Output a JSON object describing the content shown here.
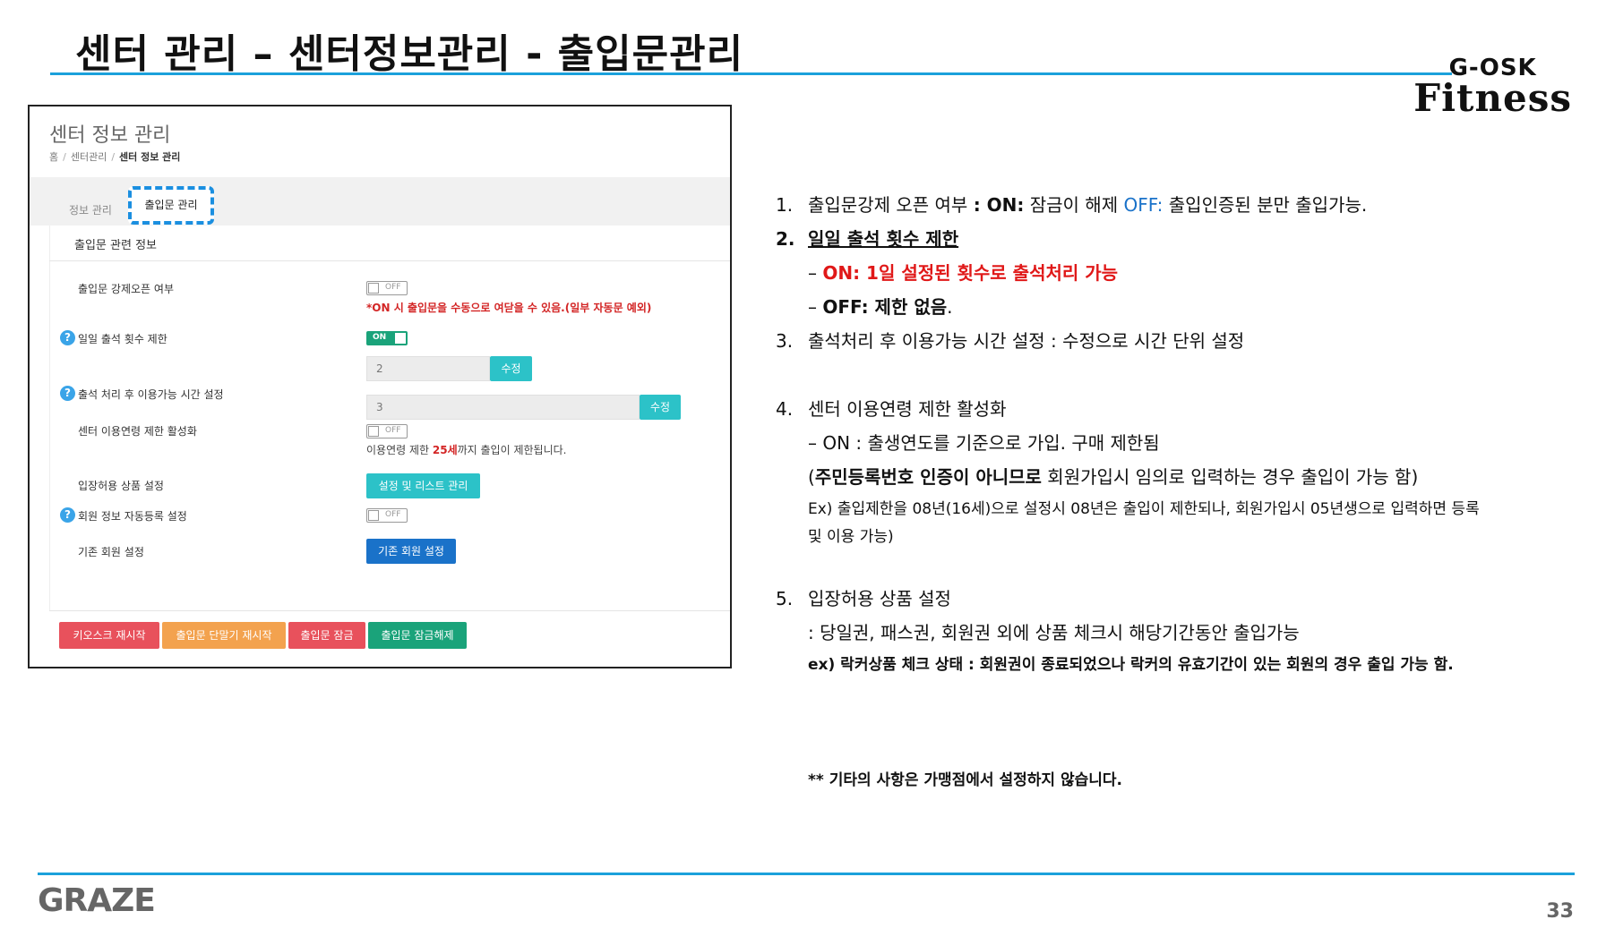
{
  "slide": {
    "title": "센터 관리 – 센터정보관리 - 출입문관리",
    "brand_top": "G-OSK",
    "brand_main": "Fitness",
    "logo": "GRAZE",
    "page": "33"
  },
  "app": {
    "title": "센터 정보 관리",
    "breadcrumb": [
      "홈",
      "센터관리",
      "센터 정보 관리"
    ],
    "tabs": [
      {
        "label": "정보 관리",
        "active": false
      },
      {
        "label": "출입문 관리",
        "active": true
      }
    ],
    "section_header": "출입문 관련 정보",
    "rows": {
      "force_open_label": "출입문 강제오픈 여부",
      "force_open_state": "OFF",
      "force_open_note": "*ON 시 출입문을 수동으로 여닫을 수 있음.(일부 자동문 예외)",
      "daily_limit_label": "일일 출석 횟수 제한",
      "daily_limit_state": "ON",
      "daily_limit_value": "2",
      "daily_limit_button": "수정",
      "usage_time_label": "출석 처리 후 이용가능 시간 설정",
      "usage_time_value": "3",
      "usage_time_button": "수정",
      "age_limit_label": "센터 이용연령 제한 활성화",
      "age_limit_state": "OFF",
      "age_limit_note_prefix": "이용연령 제한 ",
      "age_limit_note_age": "25세",
      "age_limit_note_suffix": "까지 출입이 제한됩니다.",
      "product_label": "입장허용 상품 설정",
      "product_button": "설정 및 리스트 관리",
      "auto_reg_label": "회원 정보 자동등록 설정",
      "auto_reg_state": "OFF",
      "existing_label": "기존 회원 설정",
      "existing_button": "기존 회원 설정"
    },
    "bottom_buttons": [
      {
        "label": "키오스크 재시작",
        "color": "#e8515c"
      },
      {
        "label": "출입문 단말기 재시작",
        "color": "#f3a24e"
      },
      {
        "label": "출입문 잠금",
        "color": "#e8515c"
      },
      {
        "label": "출입문 잠금해제",
        "color": "#1aa37a"
      }
    ]
  },
  "desc": {
    "i1_num": "1.",
    "i1_a": "출입문강제 오픈 여부 ",
    "i1_b": ": ON:",
    "i1_c": " 잠금이 해제   ",
    "i1_d": "OFF:",
    "i1_e": " 출입인증된 분만 출입가능.",
    "i2_num": "2.",
    "i2_title": "일일 출석 횟수 제한",
    "i2_on_dash": "– ",
    "i2_on": "ON: 1일 설정된 횟수로 출석처리 가능",
    "i2_off_dash": "– ",
    "i2_off": "OFF: 제한 없음",
    "i2_off_dot": ".",
    "i3_num": "3.",
    "i3": "출석처리 후 이용가능 시간 설정 : 수정으로 시간 단위 설정",
    "i4_num": "4.",
    "i4": "센터 이용연령 제한 활성화",
    "i4_on": "–   ON : 출생연도를 기준으로 가입. 구매 제한됨",
    "i4_note_a": "(",
    "i4_note_b": "주민등록번호 인증이 아니므로",
    "i4_note_c": " 회원가입시 임의로 입력하는 경우 출입이 가능 함)",
    "i4_ex1": "Ex) 출입제한을 08년(16세)으로 설정시 08년은 출입이 제한되나, 회원가입시 05년생으로 입력하면 등록",
    "i4_ex2": "및 이용 가능)",
    "i5_num": "5.",
    "i5": "입장허용 상품 설정",
    "i5_a": ": 당일권, 패스권, 회원권 외에 상품 체크시 해당기간동안 출입가능",
    "i5_b": "ex) 락커상품 체크 상태 : 회원권이 종료되었으나 락커의 유효기간이 있는 회원의 경우 출입 가능 함.",
    "footnote": "** 기타의 사항은 가맹점에서 설정하지 않습니다."
  }
}
